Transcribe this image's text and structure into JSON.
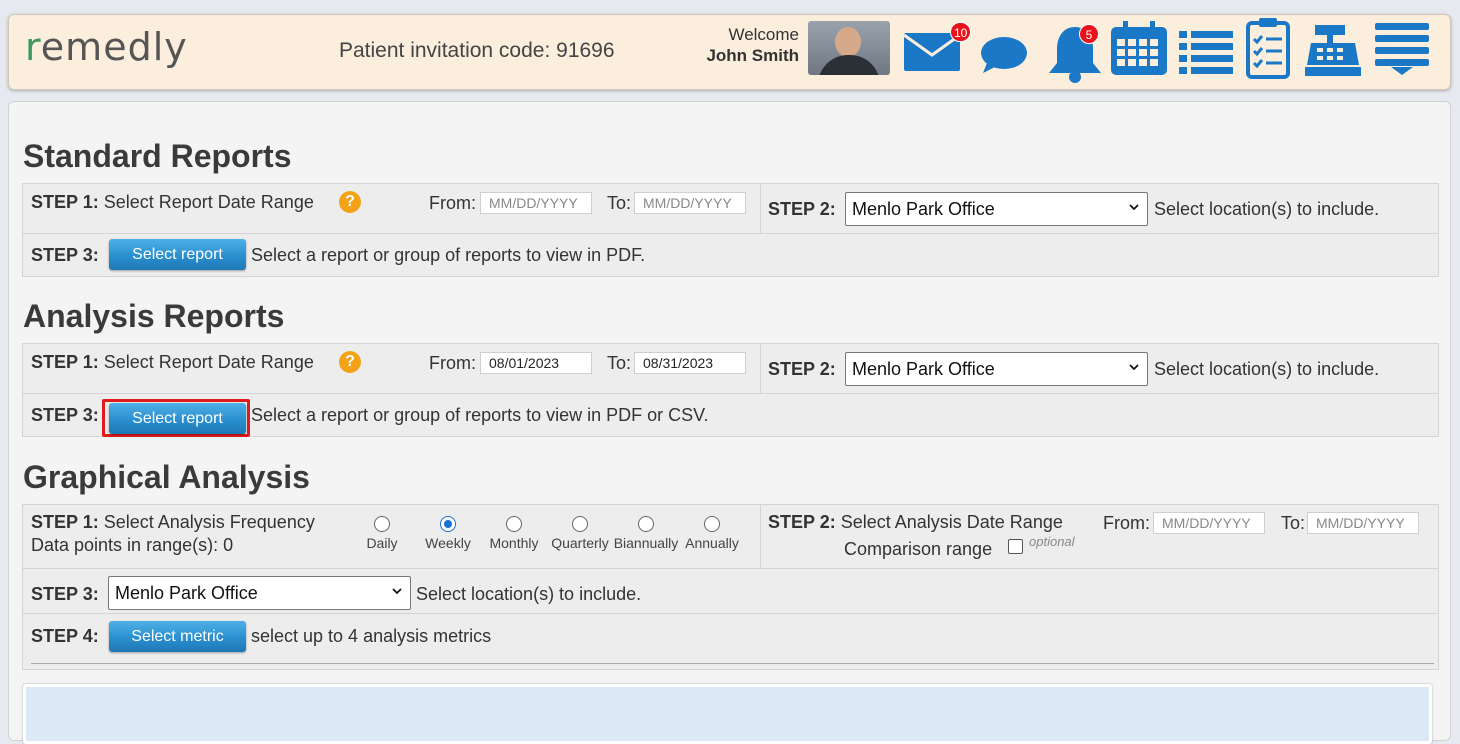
{
  "header": {
    "logo": "remedly",
    "invite_label": "Patient invitation code: 91696",
    "welcome": "Welcome",
    "user_name": "John Smith",
    "mail_badge": "10",
    "bell_badge": "5",
    "accent": "#1b78c6"
  },
  "standard": {
    "title": "Standard Reports",
    "step1_label": "STEP 1:",
    "step1_text": "Select Report Date Range",
    "help": "?",
    "from_label": "From:",
    "from_placeholder": "MM/DD/YYYY",
    "to_label": "To:",
    "to_placeholder": "MM/DD/YYYY",
    "step2_label": "STEP 2:",
    "location": "Menlo Park Office",
    "step2_text": "Select location(s) to include.",
    "step3_label": "STEP 3:",
    "button": "Select report",
    "step3_text": "Select a report or group of reports to view in PDF."
  },
  "analysis": {
    "title": "Analysis Reports",
    "step1_label": "STEP 1:",
    "step1_text": "Select Report Date Range",
    "help": "?",
    "from_label": "From:",
    "from_value": "08/01/2023",
    "to_label": "To:",
    "to_value": "08/31/2023",
    "step2_label": "STEP 2:",
    "location": "Menlo Park Office",
    "step2_text": "Select location(s) to include.",
    "step3_label": "STEP 3:",
    "button": "Select report",
    "step3_text": "Select a report or group of reports to view in PDF or CSV."
  },
  "graphical": {
    "title": "Graphical Analysis",
    "step1_label": "STEP 1:",
    "step1_text": "Select Analysis Frequency",
    "data_points": "Data points in range(s): 0",
    "frequencies": [
      "Daily",
      "Weekly",
      "Monthly",
      "Quarterly",
      "Biannually",
      "Annually"
    ],
    "selected_frequency": "Weekly",
    "step2_label": "STEP 2:",
    "step2_text": "Select Analysis Date Range",
    "from_label": "From:",
    "from_placeholder": "MM/DD/YYYY",
    "to_label": "To:",
    "to_placeholder": "MM/DD/YYYY",
    "comparison_label": "Comparison range",
    "optional": "optional",
    "step3_label": "STEP 3:",
    "location": "Menlo Park Office",
    "step3_text": "Select location(s) to include.",
    "step4_label": "STEP 4:",
    "button": "Select metric",
    "step4_text": "select up to 4 analysis metrics"
  }
}
